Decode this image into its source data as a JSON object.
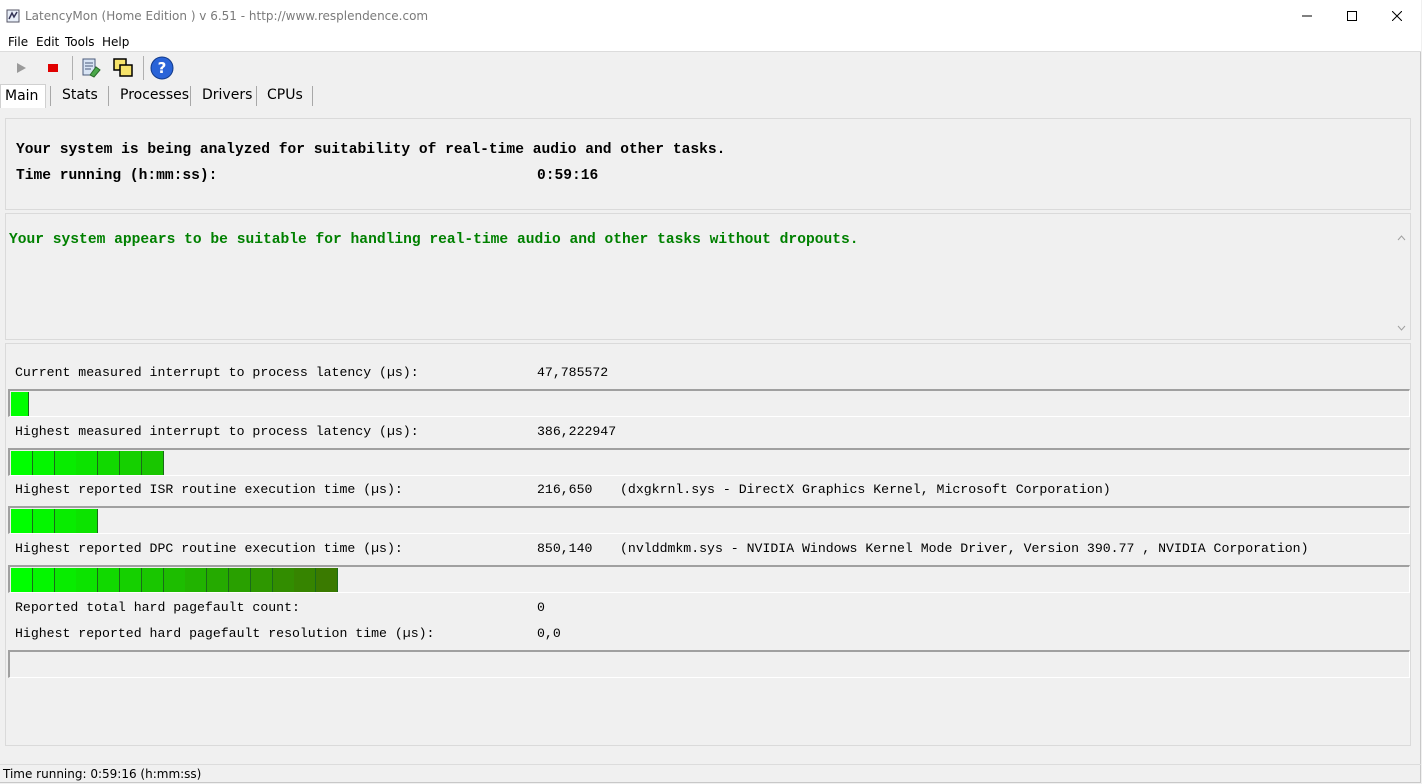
{
  "window": {
    "title": "LatencyMon  (Home Edition )  v 6.51 - http://www.resplendence.com"
  },
  "menu": {
    "items": [
      "File",
      "Edit",
      "Tools",
      "Help"
    ]
  },
  "toolbar": {
    "icons": [
      "play-icon",
      "stop-icon",
      "report-icon",
      "windows-icon",
      "help-icon"
    ]
  },
  "tabs": [
    "Main",
    "Stats",
    "Processes",
    "Drivers",
    "CPUs"
  ],
  "active_tab": "Main",
  "summary": {
    "analyzing_text": "Your system is being analyzed for suitability of real-time audio and other tasks.",
    "time_label": "Time running (h:mm:ss):",
    "time_value": "0:59:16"
  },
  "verdict": {
    "text": "Your system appears to be suitable for handling real-time audio and other tasks without dropouts.",
    "color": "#008000"
  },
  "metrics": [
    {
      "label": "Current measured interrupt to process latency (µs):",
      "value": "47,785572",
      "detail": "",
      "bar_segments": 1
    },
    {
      "label": "Highest measured interrupt to process latency (µs):",
      "value": "386,222947",
      "detail": "",
      "bar_segments": 7
    },
    {
      "label": "Highest reported ISR routine execution time (µs):",
      "value": "216,650",
      "detail": "(dxgkrnl.sys - DirectX Graphics Kernel, Microsoft Corporation)",
      "bar_segments": 4
    },
    {
      "label": "Highest reported DPC routine execution time (µs):",
      "value": "850,140",
      "detail": "(nvlddmkm.sys - NVIDIA Windows Kernel Mode Driver, Version 390.77 , NVIDIA Corporation)",
      "bar_segments": 15
    }
  ],
  "pagefault": {
    "count_label": "Reported total hard pagefault count:",
    "count_value": "0",
    "time_label": "Highest reported hard pagefault resolution time (µs):",
    "time_value": "0,0",
    "bar_segments": 0
  },
  "statusbar": {
    "text": "Time running: 0:59:16  (h:mm:ss)"
  },
  "colors": {
    "bar_light": "#00ff00",
    "bar_dark": "#3a7a00"
  }
}
